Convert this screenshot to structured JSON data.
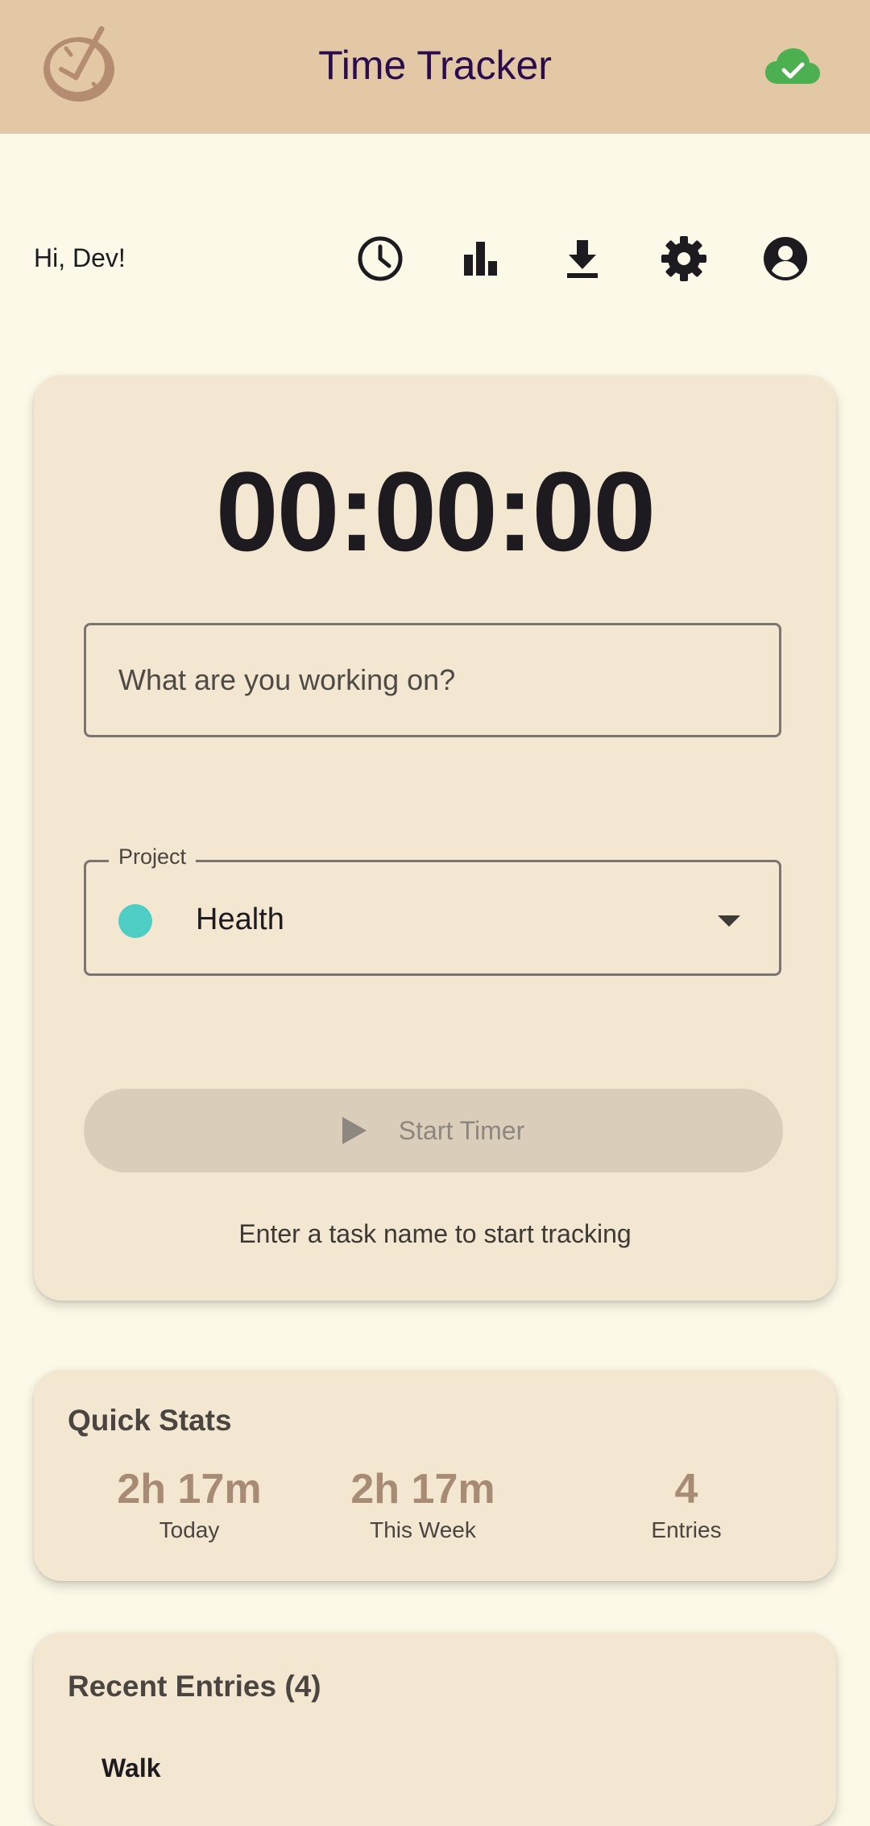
{
  "appbar": {
    "title": "Time Tracker",
    "logo_icon": "clock-check-logo",
    "sync_icon": "cloud-check-icon",
    "sync_color": "#4caf50"
  },
  "header": {
    "greeting": "Hi, Dev!",
    "nav_icons": [
      "history-clock-icon",
      "bar-chart-icon",
      "download-icon",
      "settings-gear-icon",
      "account-circle-icon"
    ]
  },
  "timer": {
    "display": "00:00:00",
    "task_placeholder": "What are you working on?",
    "task_value": "",
    "project_label": "Project",
    "project_value": "Health",
    "project_color": "#4ecdc4",
    "start_label": "Start Timer",
    "hint": "Enter a task name to start tracking"
  },
  "stats": {
    "title": "Quick Stats",
    "items": [
      {
        "value": "2h 17m",
        "label": "Today"
      },
      {
        "value": "2h 17m",
        "label": "This Week"
      },
      {
        "value": "4",
        "label": "Entries"
      }
    ]
  },
  "recent": {
    "title": "Recent Entries (4)",
    "entries": [
      {
        "name": "Walk"
      }
    ]
  }
}
